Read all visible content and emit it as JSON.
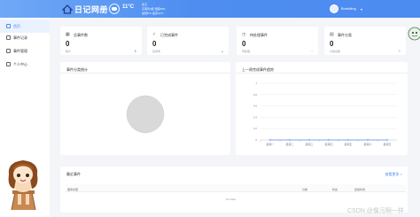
{
  "header": {
    "app_title": "日记网册",
    "temperature": "11°C",
    "weather_lines": [
      "多云",
      "东南风3级 湿度59%",
      "最低8°C 最高13°C"
    ],
    "user_name": "Bumbling",
    "user_caret": "▾"
  },
  "sidebar": {
    "items": [
      {
        "label": "首页",
        "icon": "home-icon",
        "active": true
      },
      {
        "label": "事件记录",
        "icon": "folder-icon",
        "active": false
      },
      {
        "label": "事件管理",
        "icon": "document-icon",
        "active": false
      },
      {
        "label": "个人中心",
        "icon": "user-icon",
        "active": false
      }
    ]
  },
  "stats": [
    {
      "icon": "calendar-icon",
      "icon_glyph": "▦",
      "title": "总事件数",
      "value": "0",
      "sub": "统计",
      "trend": "$",
      "trend_color": "#999999"
    },
    {
      "icon": "check-icon",
      "icon_glyph": "✓",
      "title": "已完成事件",
      "value": "0",
      "sub": "完成率",
      "trend": "◒",
      "trend_color": "#3bb34a"
    },
    {
      "icon": "clock-icon",
      "icon_glyph": "◷",
      "title": "待处理事件",
      "value": "0",
      "sub": "待处理",
      "trend": "◔",
      "trend_color": "#f0a33c"
    },
    {
      "icon": "file-icon",
      "icon_glyph": "▤",
      "title": "事件分类",
      "value": "0",
      "sub": "分类总数",
      "trend": "≡",
      "trend_color": "#999999"
    }
  ],
  "pie_panel": {
    "title": "事件分类统计"
  },
  "line_panel": {
    "title": "上一周完成事件趋势"
  },
  "chart_data": [
    {
      "type": "pie",
      "title": "事件分类统计",
      "slices": []
    },
    {
      "type": "line",
      "title": "上一周完成事件趋势",
      "categories": [
        "星期一",
        "星期二",
        "星期三",
        "星期四",
        "星期五",
        "星期六",
        "星期日"
      ],
      "series": [
        {
          "values": [
            0,
            0,
            0,
            0,
            0,
            0,
            0
          ]
        }
      ],
      "yticks": [
        "1",
        "0.8",
        "0.6",
        "0.4",
        "0.2",
        "0"
      ],
      "ylim": [
        0,
        1
      ],
      "grid": true,
      "colors": {
        "line": "#5b8ff9"
      }
    }
  ],
  "recent_events": {
    "title": "最近事件",
    "more_link": "查看更多 >",
    "columns": [
      "事件标题",
      "分类",
      "状态",
      "完成时间"
    ],
    "empty_text": "No Data"
  },
  "watermark": "CSDN @像污啊一样",
  "colors": {
    "primary": "#4c8bf0",
    "pie_fill": "#d9d9d9"
  }
}
